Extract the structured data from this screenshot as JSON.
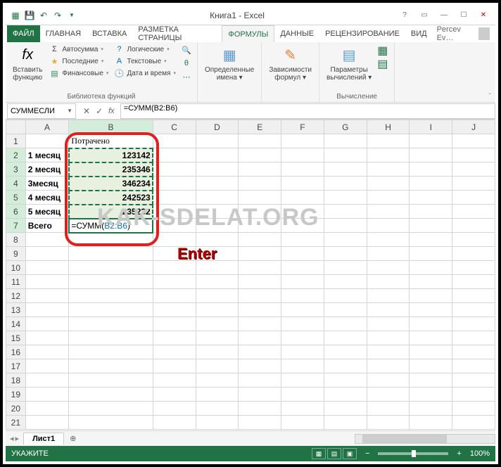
{
  "title": "Книга1 - Excel",
  "qat_icons": [
    "excel-icon",
    "save-icon",
    "undo-icon",
    "redo-icon",
    "dropdown-icon"
  ],
  "tabs": {
    "file": "ФАЙЛ",
    "items": [
      "ГЛАВНАЯ",
      "ВСТАВКА",
      "РАЗМЕТКА СТРАНИЦЫ",
      "ФОРМУЛЫ",
      "ДАННЫЕ",
      "РЕЦЕНЗИРОВАНИЕ",
      "ВИД"
    ],
    "active_index": 3
  },
  "user": "Percev Ev…",
  "ribbon": {
    "insert_fn": {
      "label": "Вставить\nфункцию",
      "fx": "fx"
    },
    "lib": {
      "autosum": "Автосумма",
      "recent": "Последние",
      "financial": "Финансовые",
      "logical": "Логические",
      "text": "Текстовые",
      "datetime": "Дата и время",
      "group_label": "Библиотека функций"
    },
    "defined": "Определенные\nимена ▾",
    "audit": "Зависимости\nформул ▾",
    "calc_opt": "Параметры\nвычислений ▾",
    "calc_group": "Вычисление"
  },
  "namebox": "СУММЕСЛИ",
  "formula": "=СУММ(B2:B6)",
  "columns": [
    "A",
    "B",
    "C",
    "D",
    "E",
    "F",
    "G",
    "H",
    "I",
    "J"
  ],
  "rows": [
    1,
    2,
    3,
    4,
    5,
    6,
    7,
    8,
    9,
    10,
    11,
    12,
    13,
    14,
    15,
    16,
    17,
    18,
    19,
    20,
    21
  ],
  "cells": {
    "B1": "Потрачено",
    "A2": "1 месяц",
    "B2": "123142",
    "A3": "2 месяц",
    "B3": "235346",
    "A4": "3месяц",
    "B4": "346234",
    "A5": "4 месяц",
    "B5": "242523",
    "A6": "5 месяц",
    "B6": "235232",
    "A7": "Всего",
    "B7_prefix": "=СУММ(",
    "B7_ref": "B2:B6",
    "B7_suffix": ")"
  },
  "annot_enter": "Enter",
  "watermark": "KAK-SDELAT.ORG",
  "sheet_tab": "Лист1",
  "status": "УКАЖИТЕ",
  "zoom": "100%"
}
